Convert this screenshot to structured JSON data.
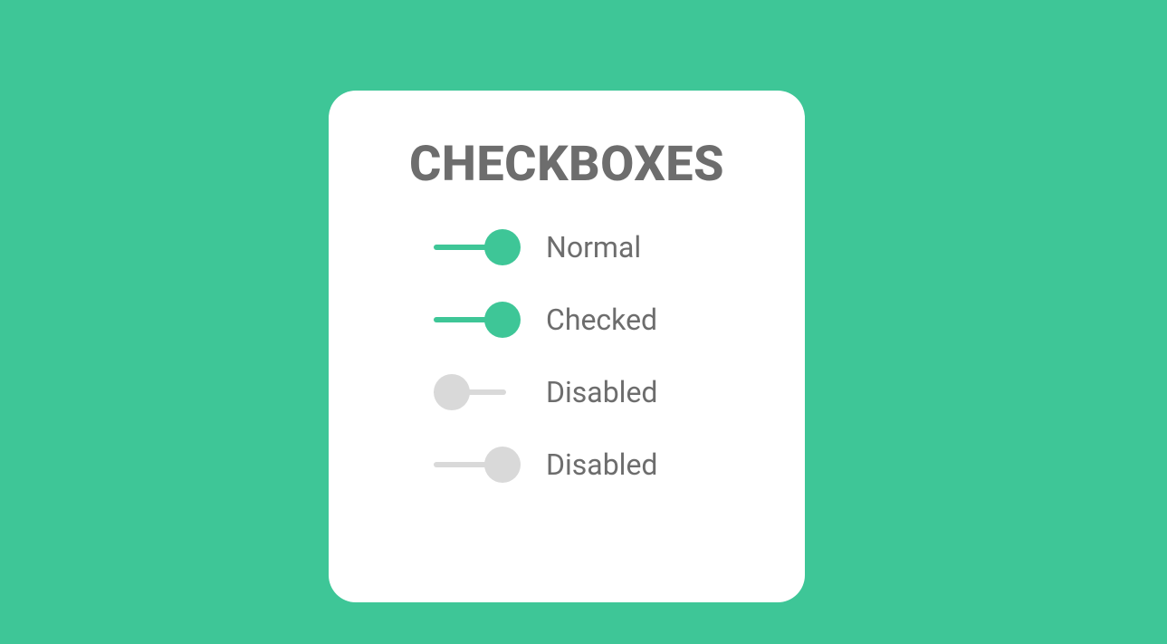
{
  "colors": {
    "background": "#3ec697",
    "accent": "#3ec697",
    "text": "#6d6d6d",
    "disabled": "#d9d9d9",
    "card": "#ffffff"
  },
  "card": {
    "title": "CHECKBOXES",
    "options": [
      {
        "label": "Normal",
        "state": "on",
        "interactable": true
      },
      {
        "label": "Checked",
        "state": "on",
        "interactable": true
      },
      {
        "label": "Disabled",
        "state": "off",
        "interactable": false
      },
      {
        "label": "Disabled",
        "state": "disabled-on",
        "interactable": false
      }
    ]
  }
}
